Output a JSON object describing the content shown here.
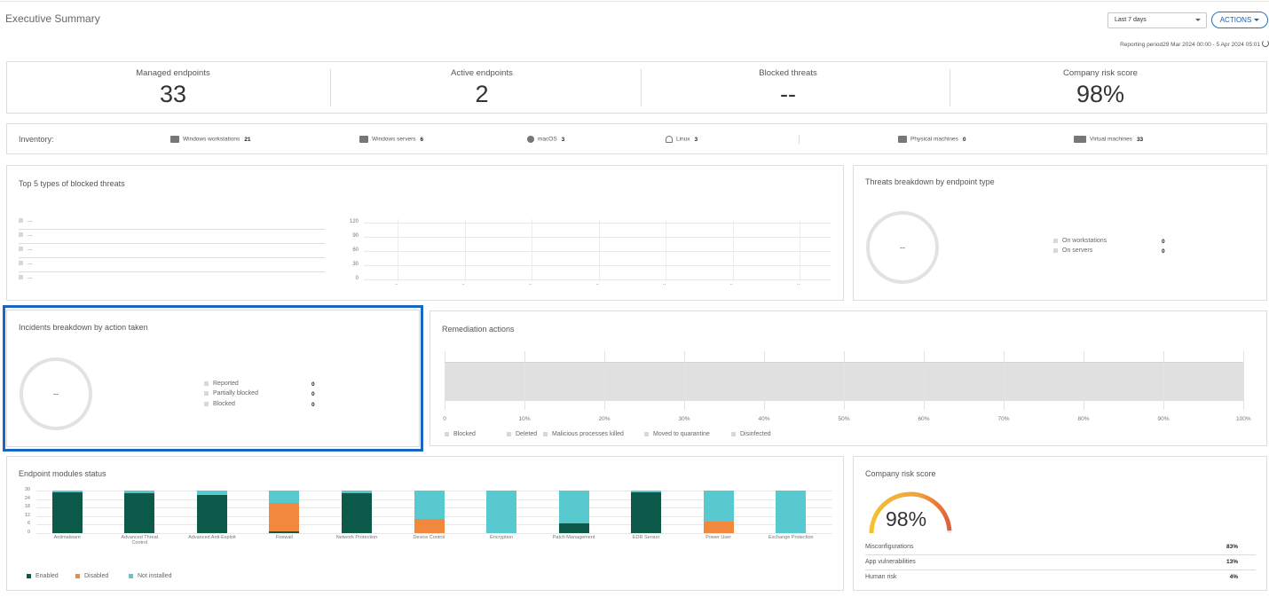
{
  "page": {
    "title": "Executive Summary",
    "range_select": "Last 7 days",
    "actions_label": "ACTIONS",
    "reporting_period": "Reporting period29 Mar 2024 00:00 - 5 Apr 2024 05:01"
  },
  "kpis": [
    {
      "label": "Managed endpoints",
      "value": "33"
    },
    {
      "label": "Active endpoints",
      "value": "2"
    },
    {
      "label": "Blocked threats",
      "value": "--"
    },
    {
      "label": "Company risk score",
      "value": "98%"
    }
  ],
  "inventory": {
    "label": "Inventory:",
    "items": [
      {
        "label": "Windows workstations",
        "count": "21",
        "icon": "windows-icon"
      },
      {
        "label": "Windows servers",
        "count": "6",
        "icon": "windows-server-icon"
      },
      {
        "label": "macOS",
        "count": "3",
        "icon": "apple-icon"
      },
      {
        "label": "Linux",
        "count": "3",
        "icon": "linux-icon"
      },
      {
        "label": "Physical machines",
        "count": "0",
        "icon": "monitor-icon"
      },
      {
        "label": "Virtual machines",
        "count": "33",
        "icon": "virtual-machine-icon"
      }
    ]
  },
  "top_threats": {
    "title": "Top 5 types of blocked threats",
    "items": [
      "...",
      "...",
      "...",
      "...",
      "..."
    ],
    "y_ticks": [
      "120",
      "90",
      "60",
      "30",
      "0"
    ],
    "x_ticks": [
      "..",
      "..",
      "..",
      "..",
      "..",
      "..",
      ".."
    ]
  },
  "threats_by_endpoint": {
    "title": "Threats breakdown by endpoint type",
    "center": "--",
    "legend": [
      {
        "label": "On workstations",
        "value": "0"
      },
      {
        "label": "On servers",
        "value": "0"
      }
    ]
  },
  "incidents": {
    "title": "Incidents breakdown by action taken",
    "center": "--",
    "legend": [
      {
        "label": "Reported",
        "value": "0"
      },
      {
        "label": "Partially blocked",
        "value": "0"
      },
      {
        "label": "Blocked",
        "value": "0"
      }
    ]
  },
  "remediation": {
    "title": "Remediation actions",
    "x_ticks": [
      "0",
      "10%",
      "20%",
      "30%",
      "40%",
      "50%",
      "60%",
      "70%",
      "80%",
      "90%",
      "100%"
    ],
    "legend": [
      "Blocked",
      "Deleted",
      "Malicious processes killed",
      "Moved to quarantine",
      "Disinfected"
    ]
  },
  "modules": {
    "title": "Endpoint modules status",
    "y_ticks": [
      "30",
      "24",
      "18",
      "12",
      "6",
      "0"
    ],
    "colors": {
      "enabled": "#0d5a4b",
      "disabled": "#f2883d",
      "not_installed": "#57c9cf"
    },
    "legend": [
      "Enabled",
      "Disabled",
      "Not installed"
    ],
    "chart_data": {
      "type": "bar",
      "categories": [
        "Antimalware",
        "Advanced Threat Control",
        "Advanced Anti-Exploit",
        "Firewall",
        "Network Protection",
        "Device Control",
        "Encryption",
        "Patch Management",
        "EDR Sensor",
        "Power User",
        "Exchange Protection"
      ],
      "series": [
        {
          "name": "Enabled",
          "values": [
            29,
            28,
            27,
            1,
            28,
            0,
            0,
            7,
            29,
            0,
            0
          ]
        },
        {
          "name": "Disabled",
          "values": [
            0,
            1,
            0,
            20,
            1,
            10,
            0,
            0,
            0,
            8,
            0
          ]
        },
        {
          "name": "Not installed",
          "values": [
            1,
            1,
            3,
            9,
            1,
            20,
            30,
            23,
            1,
            22,
            30
          ]
        }
      ],
      "ylim": [
        0,
        30
      ]
    }
  },
  "risk": {
    "title": "Company risk score",
    "score": "98%",
    "gauge_fraction": 0.98,
    "rows": [
      {
        "label": "Misconfigurations",
        "value": "83%"
      },
      {
        "label": "App vulnerabilities",
        "value": "13%"
      },
      {
        "label": "Human risk",
        "value": "4%"
      }
    ]
  }
}
